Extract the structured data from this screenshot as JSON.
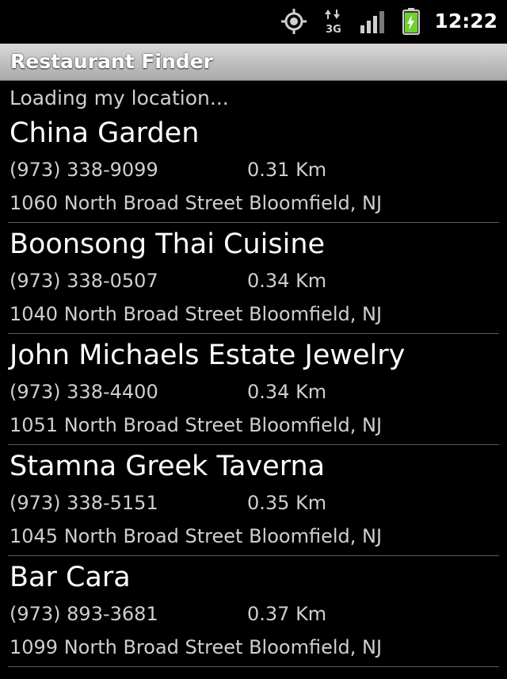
{
  "status_bar": {
    "time": "12:22",
    "network": "3G",
    "icons": [
      "gps-icon",
      "data-3g-icon",
      "signal-icon",
      "battery-charging-icon"
    ]
  },
  "app": {
    "title": "Restaurant Finder",
    "loading_message": "Loading my location..."
  },
  "restaurants": [
    {
      "name": "China Garden",
      "phone": "(973) 338-9099",
      "distance": "0.31 Km",
      "address": "1060 North Broad Street Bloomfield, NJ"
    },
    {
      "name": "Boonsong Thai Cuisine",
      "phone": "(973) 338-0507",
      "distance": "0.34 Km",
      "address": "1040 North Broad Street Bloomfield, NJ"
    },
    {
      "name": "John Michaels Estate Jewelry",
      "phone": "(973) 338-4400",
      "distance": "0.34 Km",
      "address": "1051 North Broad Street Bloomfield, NJ"
    },
    {
      "name": "Stamna Greek Taverna",
      "phone": "(973) 338-5151",
      "distance": "0.35 Km",
      "address": "1045 North Broad Street Bloomfield, NJ"
    },
    {
      "name": "Bar Cara",
      "phone": "(973) 893-3681",
      "distance": "0.37 Km",
      "address": "1099 North Broad Street Bloomfield, NJ"
    }
  ],
  "colors": {
    "background": "#000000",
    "title_bar_top": "#d9d9d9",
    "title_bar_bottom": "#a9a9a9",
    "battery_green": "#6fd12e",
    "primary_text": "#ffffff",
    "secondary_text": "#cfcfcf",
    "divider": "#5a5a5a"
  }
}
